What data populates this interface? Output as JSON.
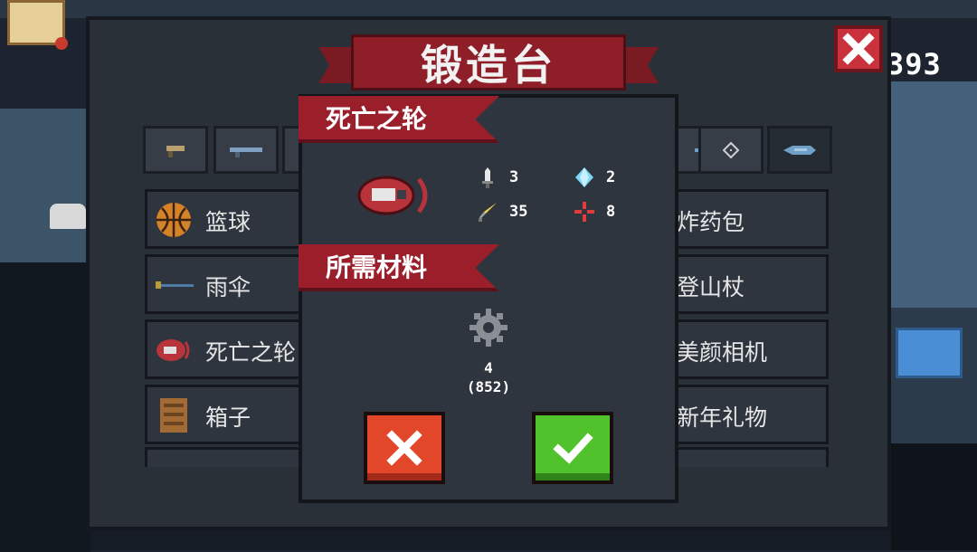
{
  "hud": {
    "coin_count": "393"
  },
  "forge": {
    "title": "锻造台",
    "tabs": [
      {
        "icon": "pistol-icon"
      },
      {
        "icon": "rifle-icon"
      },
      {
        "icon": "gun-icon"
      },
      {
        "icon": "sniper-icon"
      },
      {
        "icon": "crosshair-icon"
      },
      {
        "icon": "fish-gun-icon"
      }
    ],
    "items_left": [
      {
        "label": "篮球",
        "icon": "basketball-icon"
      },
      {
        "label": "雨伞",
        "icon": "umbrella-icon"
      },
      {
        "label": "死亡之轮",
        "icon": "wheel-icon"
      },
      {
        "label": "箱子",
        "icon": "box-icon"
      }
    ],
    "items_right": [
      {
        "label": "炸药包"
      },
      {
        "label": "登山杖"
      },
      {
        "label": "美颜相机"
      },
      {
        "label": "新年礼物"
      }
    ]
  },
  "dialog": {
    "weapon_name": "死亡之轮",
    "materials_heading": "所需材料",
    "stats": {
      "damage": "3",
      "energy": "2",
      "crit": "35",
      "accuracy": "8"
    },
    "material": {
      "icon": "gear-icon",
      "required": "4",
      "owned": "(852)"
    },
    "cancel_icon": "x-icon",
    "confirm_icon": "checkmark-icon"
  },
  "colors": {
    "banner_red": "#9a1f2b",
    "cancel_red": "#e3472a",
    "confirm_green": "#4fc22c",
    "panel": "#2a3038"
  }
}
